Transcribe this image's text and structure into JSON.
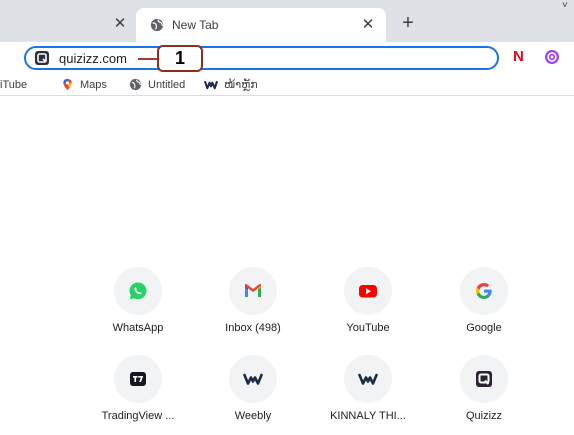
{
  "tabs": {
    "active_title": "New Tab"
  },
  "omnibox": {
    "value": "quizizz.com"
  },
  "callout": {
    "number": "1"
  },
  "extensions": {
    "netflix_letter": "N"
  },
  "bookmarks": [
    {
      "label": "iTube",
      "icon": "youtube-icon"
    },
    {
      "label": "Maps",
      "icon": "maps-pin-icon"
    },
    {
      "label": "Untitled",
      "icon": "globe-icon"
    },
    {
      "label": "ໜ້າຫຼັກ",
      "icon": "weebly-icon"
    }
  ],
  "shortcuts_row1": [
    {
      "label": "WhatsApp",
      "icon": "whatsapp-icon"
    },
    {
      "label": "Inbox (498)",
      "icon": "gmail-icon"
    },
    {
      "label": "YouTube",
      "icon": "youtube-icon"
    },
    {
      "label": "Google",
      "icon": "google-icon"
    }
  ],
  "shortcuts_row2": [
    {
      "label": "TradingView ...",
      "icon": "tradingview-icon"
    },
    {
      "label": "Weebly",
      "icon": "weebly-icon"
    },
    {
      "label": "KINNALY THI...",
      "icon": "weebly-icon"
    },
    {
      "label": "Quizizz",
      "icon": "quizizz-icon"
    }
  ],
  "colors": {
    "accent": "#1a73e8",
    "callout_border": "#8b2e22",
    "netflix": "#e50914"
  }
}
